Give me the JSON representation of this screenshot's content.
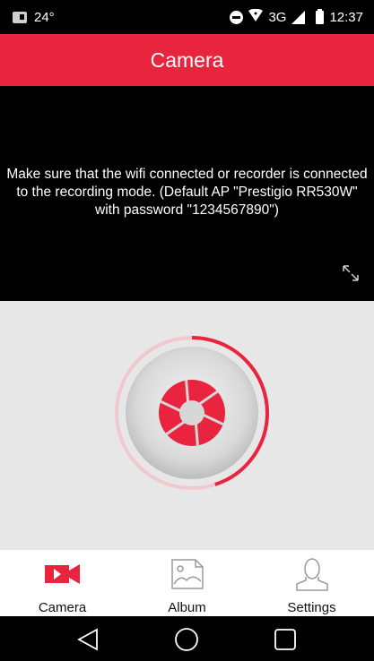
{
  "status_bar": {
    "temperature": "24°",
    "network": "3G",
    "time": "12:37"
  },
  "app_bar": {
    "title": "Camera"
  },
  "preview": {
    "message": "Make sure that the wifi connected or recorder is connected to the recording mode. (Default AP \"Prestigio RR530W\" with password \"1234567890\")"
  },
  "record": {
    "progress": 0.45,
    "accent_color": "#e8243f"
  },
  "tabs": [
    {
      "label": "Camera",
      "icon": "video-camera-icon",
      "active": true
    },
    {
      "label": "Album",
      "icon": "image-icon",
      "active": false
    },
    {
      "label": "Settings",
      "icon": "user-icon",
      "active": false
    }
  ],
  "nav": {
    "back": "back-icon",
    "home": "home-icon",
    "recents": "recents-icon"
  }
}
